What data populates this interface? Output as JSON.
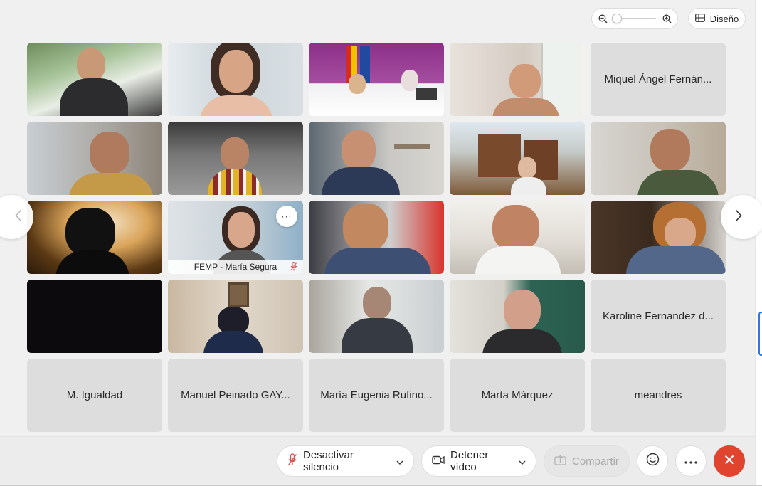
{
  "toolbar_top": {
    "zoom": {
      "level": 0.0
    },
    "layout_label": "Diseño"
  },
  "tiles": [
    {
      "kind": "video",
      "name": "participant-video"
    },
    {
      "kind": "video",
      "name": "participant-video"
    },
    {
      "kind": "video",
      "name": "participant-video"
    },
    {
      "kind": "video",
      "name": "participant-video"
    },
    {
      "kind": "name",
      "label": "Miquel Ángel Fernán..."
    },
    {
      "kind": "video",
      "name": "participant-video"
    },
    {
      "kind": "video",
      "name": "participant-video"
    },
    {
      "kind": "video",
      "name": "participant-video"
    },
    {
      "kind": "video",
      "name": "participant-video"
    },
    {
      "kind": "video",
      "name": "participant-video"
    },
    {
      "kind": "video",
      "name": "participant-video"
    },
    {
      "kind": "video",
      "name": "participant-video",
      "caption": "FEMP - María Segura",
      "more": "···"
    },
    {
      "kind": "video",
      "name": "participant-video"
    },
    {
      "kind": "video",
      "name": "participant-video"
    },
    {
      "kind": "video",
      "name": "participant-video"
    },
    {
      "kind": "video",
      "name": "participant-video"
    },
    {
      "kind": "video",
      "name": "participant-video"
    },
    {
      "kind": "video",
      "name": "participant-video"
    },
    {
      "kind": "video",
      "name": "participant-video"
    },
    {
      "kind": "name",
      "label": "Karoline Fernandez d..."
    },
    {
      "kind": "name",
      "label": "M. Igualdad"
    },
    {
      "kind": "name",
      "label": "Manuel Peinado GAY..."
    },
    {
      "kind": "name",
      "label": "María Eugenia Rufino..."
    },
    {
      "kind": "name",
      "label": "Marta Márquez"
    },
    {
      "kind": "name",
      "label": "meandres"
    }
  ],
  "controls": {
    "mute_label": "Desactivar silencio",
    "video_label": "Detener vídeo",
    "share_label": "Compartir"
  },
  "colors": {
    "end_call": "#e0432e",
    "accent": "#2a7ae2",
    "muted_mic": "#d9534f"
  }
}
